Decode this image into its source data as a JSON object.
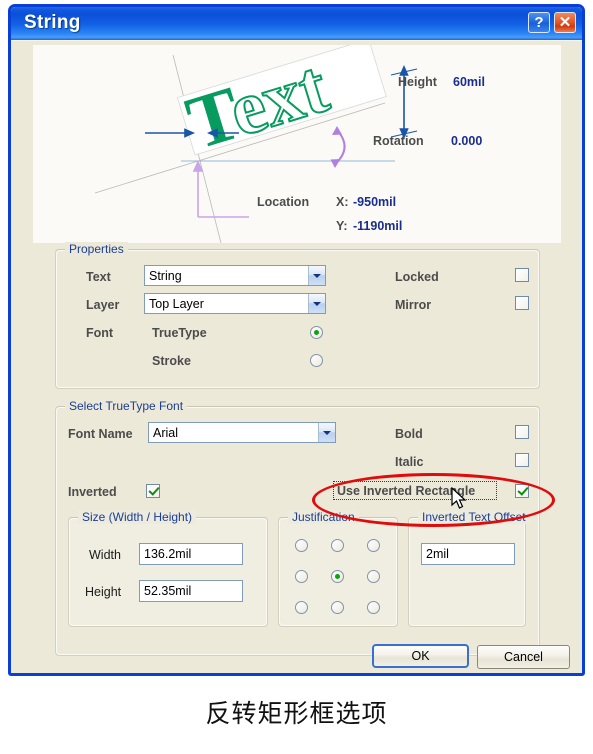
{
  "window": {
    "title": "String",
    "help_button": "?",
    "close_button": "✕"
  },
  "preview": {
    "sample_text": "Text",
    "height_label": "Height",
    "height_value": "60mil",
    "rotation_label": "Rotation",
    "rotation_value": "0.000",
    "location_label": "Location",
    "location_x_label": "X:",
    "location_x_value": "-950mil",
    "location_y_label": "Y:",
    "location_y_value": "-1190mil",
    "text_fill_color": "#089b5f",
    "annotation_value_color": "#1a2d8f",
    "annotation_label_color": "#4c4c4c"
  },
  "properties": {
    "group_label": "Properties",
    "text_label": "Text",
    "text_value": "String",
    "layer_label": "Layer",
    "layer_value": "Top Layer",
    "font_label": "Font",
    "font_truetype_label": "TrueType",
    "font_stroke_label": "Stroke",
    "font_selected": "TrueType",
    "locked_label": "Locked",
    "locked_checked": false,
    "mirror_label": "Mirror",
    "mirror_checked": false
  },
  "truetype": {
    "group_label": "Select TrueType Font",
    "font_name_label": "Font Name",
    "font_name_value": "Arial",
    "bold_label": "Bold",
    "bold_checked": false,
    "italic_label": "Italic",
    "italic_checked": false,
    "inverted_label": "Inverted",
    "inverted_checked": true,
    "use_inverted_rect_label": "Use Inverted Rectangle",
    "use_inverted_rect_checked": true
  },
  "size": {
    "group_label": "Size (Width / Height)",
    "width_label": "Width",
    "width_value": "136.2mil",
    "height_label": "Height",
    "height_value": "52.35mil"
  },
  "justification": {
    "group_label": "Justification",
    "selected_index": 4,
    "cells": [
      "top-left",
      "top-center",
      "top-right",
      "middle-left",
      "middle-center",
      "middle-right",
      "bottom-left",
      "bottom-center",
      "bottom-right"
    ]
  },
  "inverted_offset": {
    "group_label": "Inverted Text Offset",
    "value": "2mil"
  },
  "footer": {
    "ok_label": "OK",
    "cancel_label": "Cancel"
  },
  "annotation": {
    "highlight_color": "#e00c0c",
    "caption": "反转矩形框选项"
  }
}
